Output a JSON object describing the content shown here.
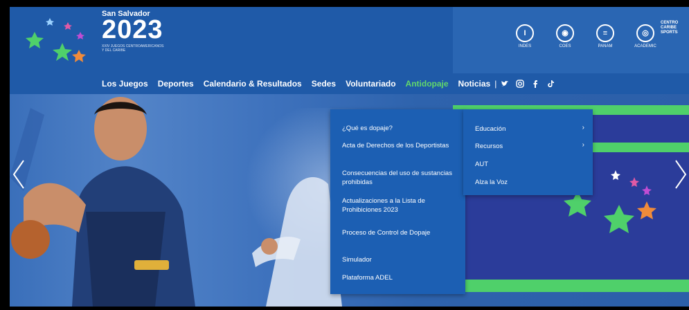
{
  "header": {
    "logo_small": "San Salvador",
    "logo_year": "2023",
    "logo_sub": "XXIV JUEGOS CENTROAMERICANOS Y DEL CARIBE",
    "sponsors": [
      "INDES",
      "COES",
      "PANAM",
      "ACADEMIC"
    ],
    "centro_lines": [
      "CENTRO",
      "CARIBE",
      "SPORTS"
    ]
  },
  "nav": {
    "items": [
      "Los Juegos",
      "Deportes",
      "Calendario & Resultados",
      "Sedes",
      "Voluntariado",
      "Antidopaje",
      "Noticias"
    ],
    "active": "Antidopaje",
    "social_icons": [
      "twitter-icon",
      "instagram-icon",
      "facebook-icon",
      "tiktok-icon"
    ]
  },
  "dropdown": {
    "items": [
      "¿Qué es dopaje?",
      "Acta de Derechos de los Deportistas",
      "Consecuencias del uso de sustancias prohibidas",
      "Actualizaciones a la Lista de Prohibiciones 2023",
      "Proceso de Control de Dopaje",
      "Simulador",
      "Plataforma ADEL"
    ]
  },
  "subdropdown": {
    "items": [
      "Educación",
      "Recursos",
      "AUT",
      "Alza la Voz"
    ],
    "has_submenu": [
      true,
      true,
      false,
      false
    ]
  },
  "colors": {
    "header_bg": "#1f5aa8",
    "active_nav": "#62d86b",
    "dropdown_bg": "#1c5fb3",
    "green_band": "#4fd06a",
    "navy_panel": "#2b3c9a"
  }
}
